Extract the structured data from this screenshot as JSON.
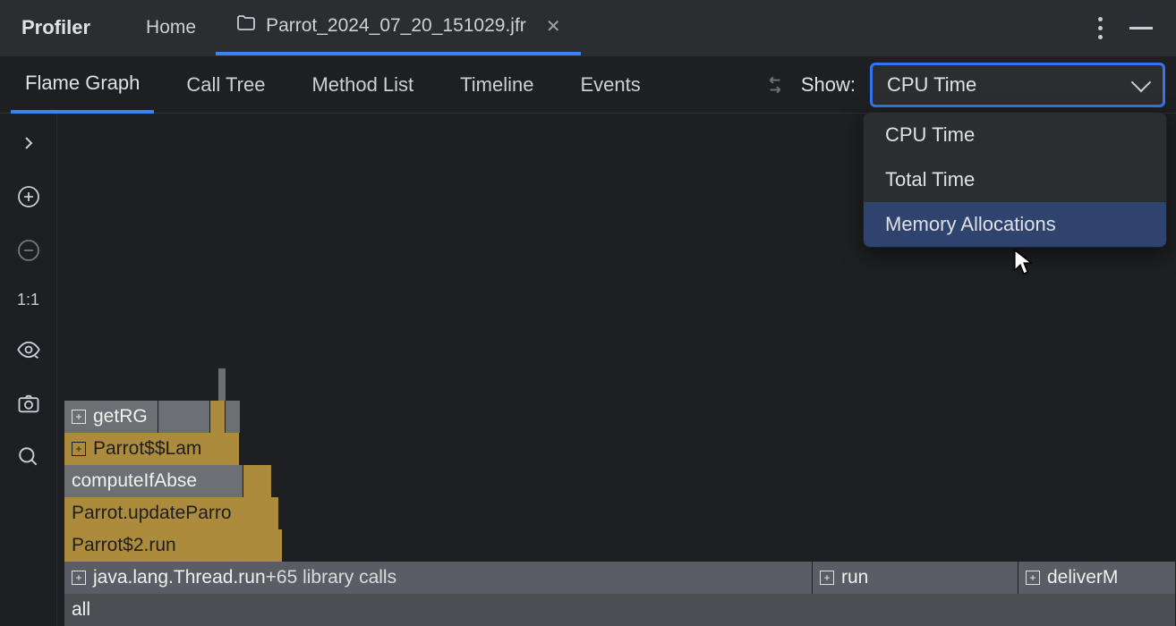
{
  "titlebar": {
    "app_title": "Profiler",
    "tabs": {
      "home": "Home",
      "file": "Parrot_2024_07_20_151029.jfr"
    }
  },
  "toolbar": {
    "views": {
      "flame_graph": "Flame Graph",
      "call_tree": "Call Tree",
      "method_list": "Method List",
      "timeline": "Timeline",
      "events": "Events"
    },
    "show_label": "Show:",
    "show_selected": "CPU Time",
    "show_options": {
      "cpu_time": "CPU Time",
      "total_time": "Total Time",
      "memory_alloc": "Memory Allocations"
    }
  },
  "rail": {
    "zoom_fit": "1:1"
  },
  "flame": {
    "rows": {
      "r0": {
        "label": "getRG"
      },
      "r1": {
        "label": "Parrot$$Lam"
      },
      "r2": {
        "label": "computeIfAbse"
      },
      "r3": {
        "label": "Parrot.updateParro"
      },
      "r4": {
        "label": "Parrot$2.run"
      },
      "r5": {
        "label": "java.lang.Thread.run",
        "suffix": " +65 library calls"
      },
      "r5b": {
        "label": "run"
      },
      "r5c": {
        "label": "deliverM"
      },
      "r6": {
        "label": "all"
      }
    }
  }
}
